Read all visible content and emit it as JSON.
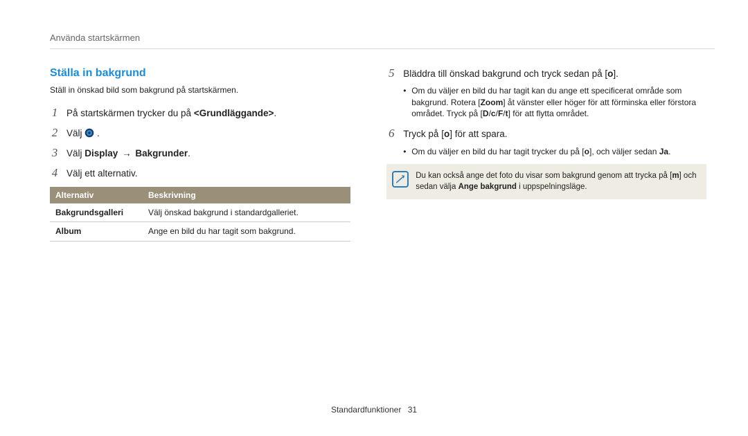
{
  "breadcrumb": "Använda startskärmen",
  "section_title": "Ställa in bakgrund",
  "intro": "Ställ in önskad bild som bakgrund på startskärmen.",
  "steps_left": {
    "s1": {
      "num": "1",
      "pre": "På startskärmen trycker du på ",
      "strong": "<Grundläggande>",
      "post": "."
    },
    "s2": {
      "num": "2",
      "text": "Välj "
    },
    "s3": {
      "num": "3",
      "pre": "Välj ",
      "strong1": "Display",
      "arrow": "→",
      "strong2": "Bakgrunder",
      "post": "."
    },
    "s4": {
      "num": "4",
      "text": "Välj ett alternativ."
    }
  },
  "table": {
    "headers": {
      "c1": "Alternativ",
      "c2": "Beskrivning"
    },
    "rows": [
      {
        "c1": "Bakgrundsgalleri",
        "c2": "Välj önskad bakgrund i standardgalleriet."
      },
      {
        "c1": "Album",
        "c2": "Ange en bild du har tagit som bakgrund."
      }
    ]
  },
  "steps_right": {
    "s5": {
      "num": "5",
      "pre": "Bläddra till önskad bakgrund och tryck sedan på [",
      "btn": "o",
      "post": "].",
      "bullets": {
        "b1_pre": "Om du väljer en bild du har tagit kan du ange ett specificerat område som bakgrund. Rotera [",
        "b1_zoom": "Zoom",
        "b1_mid": "] åt vänster eller höger för att förminska eller förstora området. Tryck på [",
        "b1_disp": "D",
        "b1_sep1": "/",
        "b1_down": "c",
        "b1_sep2": "/",
        "b1_flash": "F",
        "b1_sep3": "/",
        "b1_timer": "t",
        "b1_post": "] för att flytta området."
      }
    },
    "s6": {
      "num": "6",
      "pre": "Tryck på [",
      "btn": "o",
      "post": "] för att spara.",
      "bullets": {
        "b1_pre": "Om du väljer en bild du har tagit trycker du på [",
        "b1_btn": "o",
        "b1_mid": "], och väljer sedan ",
        "b1_ja": "Ja",
        "b1_post": "."
      }
    }
  },
  "note": {
    "pre": "Du kan också ange det foto du visar som bakgrund genom att trycka på [",
    "menu": "m",
    "mid": "] och sedan välja ",
    "strong": "Ange bakgrund",
    "post": " i uppspelningsläge."
  },
  "footer": {
    "label": "Standardfunktioner",
    "page": "31"
  }
}
